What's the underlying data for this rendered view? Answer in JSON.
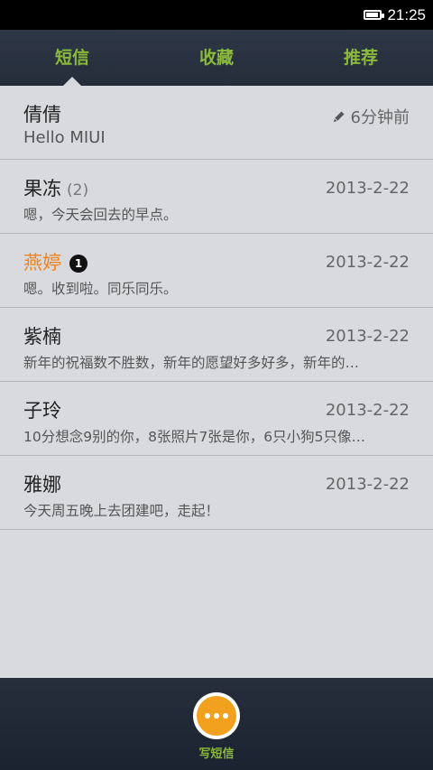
{
  "status_bar": {
    "time": "21:25",
    "battery_level": 0.9
  },
  "tabs": [
    {
      "label": "短信",
      "active": true
    },
    {
      "label": "收藏",
      "active": false
    },
    {
      "label": "推荐",
      "active": false
    }
  ],
  "accent_color": "#8ab93b",
  "unread_color": "#f2821b",
  "conversations": [
    {
      "name": "倩倩",
      "time": "6分钟前",
      "time_icon": "pencil-icon",
      "preview": "Hello MIUI"
    },
    {
      "name": "果冻",
      "count": "(2)",
      "time": "2013-2-22",
      "preview": "嗯，今天会回去的早点。"
    },
    {
      "name": "燕婷",
      "unread_badge": "1",
      "time": "2013-2-22",
      "preview": "嗯。收到啦。同乐同乐。"
    },
    {
      "name": "紫楠",
      "time": "2013-2-22",
      "preview": "新年的祝福数不胜数，新年的愿望好多好多，新年的…"
    },
    {
      "name": "子玲",
      "time": "2013-2-22",
      "preview": "10分想念9别的你，8张照片7张是你，6只小狗5只像…"
    },
    {
      "name": "雅娜",
      "time": "2013-2-22",
      "preview": "今天周五晚上去团建吧，走起！"
    }
  ],
  "compose": {
    "label": "写短信",
    "icon": "ellipsis-icon"
  }
}
